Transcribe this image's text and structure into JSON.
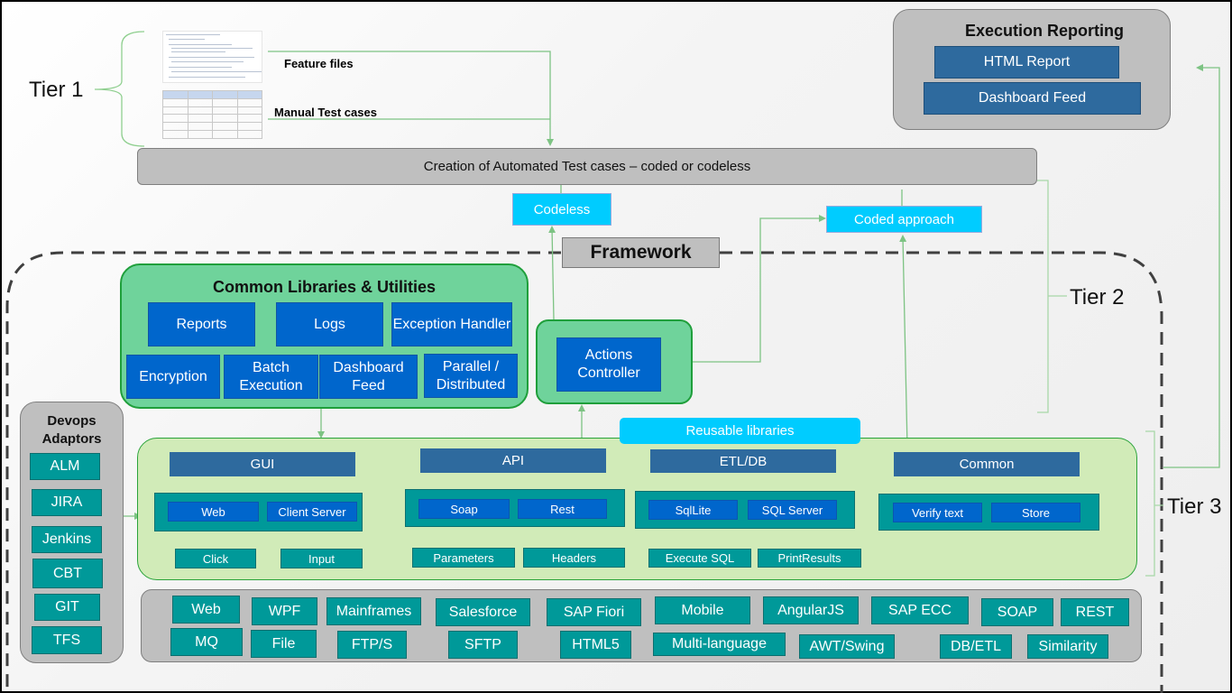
{
  "tiers": {
    "tier1": "Tier 1",
    "tier2": "Tier 2",
    "tier3": "Tier 3"
  },
  "inputs": {
    "feature_files": "Feature files",
    "manual_test_cases": "Manual Test cases"
  },
  "creation_bar": "Creation of Automated Test cases – coded or codeless",
  "approaches": {
    "codeless": "Codeless",
    "coded": "Coded approach"
  },
  "framework_label": "Framework",
  "common_libraries": {
    "title": "Common Libraries & Utilities",
    "items": [
      "Reports",
      "Logs",
      "Exception Handler",
      "Encryption",
      "Batch Execution",
      "Dashboard Feed",
      "Parallel / Distributed"
    ]
  },
  "actions_controller": "Actions Controller",
  "execution_reporting": {
    "title": "Execution Reporting",
    "items": [
      "HTML Report",
      "Dashboard Feed"
    ]
  },
  "devops": {
    "title_line1": "Devops",
    "title_line2": "Adaptors",
    "items": [
      "ALM",
      "JIRA",
      "Jenkins",
      "CBT",
      "GIT",
      "TFS"
    ]
  },
  "reusable_libraries": {
    "label": "Reusable libraries",
    "categories": [
      {
        "name": "GUI",
        "types": [
          "Web",
          "Client Server"
        ],
        "actions": [
          "Click",
          "Input"
        ]
      },
      {
        "name": "API",
        "types": [
          "Soap",
          "Rest"
        ],
        "actions": [
          "Parameters",
          "Headers"
        ]
      },
      {
        "name": "ETL/DB",
        "types": [
          "SqlLite",
          "SQL Server"
        ],
        "actions": [
          "Execute SQL",
          "PrintResults"
        ]
      },
      {
        "name": "Common",
        "types": [
          "Verify text",
          "Store"
        ],
        "actions": []
      }
    ]
  },
  "technologies": {
    "row1": [
      "Web",
      "WPF",
      "Mainframes",
      "Salesforce",
      "SAP Fiori",
      "Mobile",
      "AngularJS",
      "SAP ECC",
      "SOAP",
      "REST"
    ],
    "row2": [
      "MQ",
      "File",
      "FTP/S",
      "SFTP",
      "HTML5",
      "Multi-language",
      "AWT/Swing",
      "DB/ETL",
      "Similarity"
    ]
  },
  "colors": {
    "wire_green": "#7dc383",
    "panel_green": "#6fd39b",
    "light_green": "#d1ebb8",
    "blue": "#0066cc",
    "steel_blue": "#2e6a9e",
    "teal": "#009999",
    "cyan": "#00ccff",
    "grey": "#bfbfbf"
  }
}
